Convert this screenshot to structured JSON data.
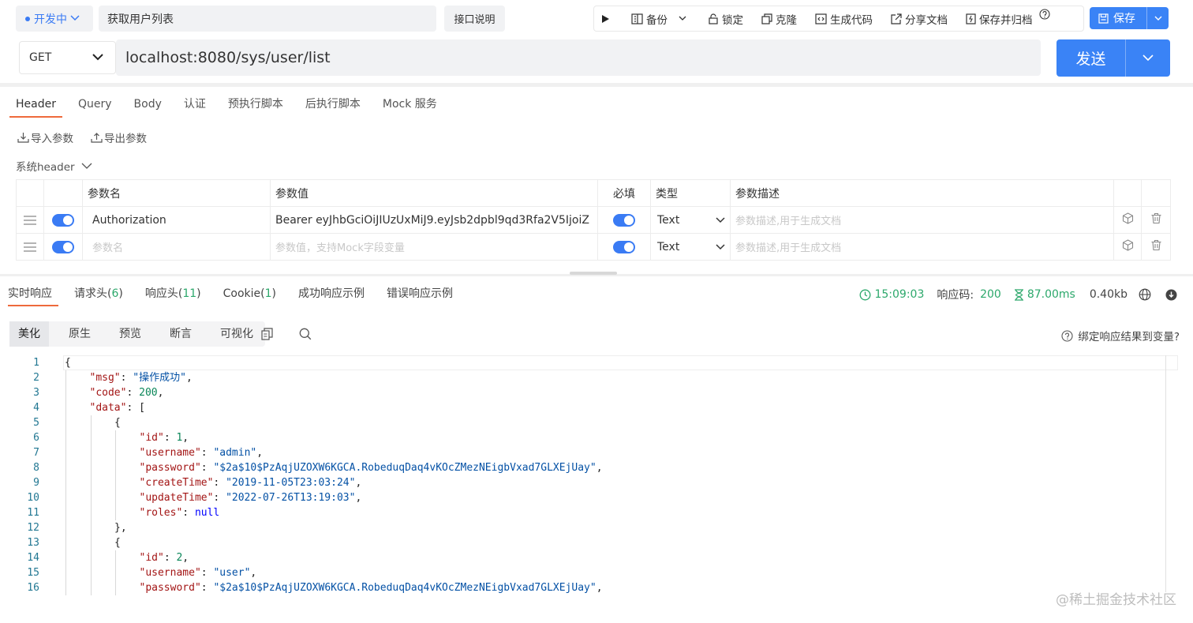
{
  "top": {
    "status_label": "开发中",
    "api_name": "获取用户列表",
    "doc_button": "接口说明",
    "toolbar": {
      "backup": "备份",
      "lock": "锁定",
      "clone": "克隆",
      "gen_code": "生成代码",
      "share_doc": "分享文档",
      "save_archive": "保存并归档"
    },
    "save_label": "保存",
    "method": "GET",
    "url": "localhost:8080/sys/user/list",
    "send_label": "发送"
  },
  "request": {
    "tabs": [
      "Header",
      "Query",
      "Body",
      "认证",
      "预执行脚本",
      "后执行脚本",
      "Mock 服务"
    ],
    "import_label": "导入参数",
    "export_label": "导出参数",
    "sys_header_label": "系统header",
    "columns": {
      "name": "参数名",
      "value": "参数值",
      "required": "必填",
      "type": "类型",
      "desc": "参数描述"
    },
    "rows": [
      {
        "name": "Authorization",
        "value": "Bearer  eyJhbGciOiJIUzUxMiJ9.eyJsb2dpbl9qd3Rfa2V5IjoiZ",
        "type": "Text",
        "desc_placeholder": "参数描述,用于生成文档"
      }
    ],
    "new_row": {
      "name_placeholder": "参数名",
      "value_placeholder": "参数值，支持Mock字段变量",
      "type": "Text",
      "desc_placeholder": "参数描述,用于生成文档"
    }
  },
  "response": {
    "tabs": [
      {
        "label": "实时响应",
        "count": ""
      },
      {
        "label": "请求头(",
        "count": "6",
        "suffix": ")"
      },
      {
        "label": "响应头(",
        "count": "11",
        "suffix": ")"
      },
      {
        "label": "Cookie(",
        "count": "1",
        "suffix": ")"
      },
      {
        "label": "成功响应示例",
        "count": ""
      },
      {
        "label": "错误响应示例",
        "count": ""
      }
    ],
    "time": "15:09:03",
    "code_label": "响应码:",
    "code": "200",
    "duration": "87.00ms",
    "size": "0.40kb",
    "view_tabs": [
      "美化",
      "原生",
      "预览",
      "断言",
      "可视化"
    ],
    "bind_label": "绑定响应结果到变量?",
    "watermark": "@稀土掘金技术社区",
    "code_lines": [
      {
        "n": "1",
        "indent": 0,
        "tokens": [
          [
            "p",
            "{"
          ]
        ]
      },
      {
        "n": "2",
        "indent": 1,
        "tokens": [
          [
            "k",
            "\"msg\""
          ],
          [
            "p",
            ": "
          ],
          [
            "s",
            "\"操作成功\""
          ],
          [
            "p",
            ","
          ]
        ]
      },
      {
        "n": "3",
        "indent": 1,
        "tokens": [
          [
            "k",
            "\"code\""
          ],
          [
            "p",
            ": "
          ],
          [
            "n",
            "200"
          ],
          [
            "p",
            ","
          ]
        ]
      },
      {
        "n": "4",
        "indent": 1,
        "tokens": [
          [
            "k",
            "\"data\""
          ],
          [
            "p",
            ": ["
          ]
        ]
      },
      {
        "n": "5",
        "indent": 2,
        "tokens": [
          [
            "p",
            "{"
          ]
        ]
      },
      {
        "n": "6",
        "indent": 3,
        "tokens": [
          [
            "k",
            "\"id\""
          ],
          [
            "p",
            ": "
          ],
          [
            "n",
            "1"
          ],
          [
            "p",
            ","
          ]
        ]
      },
      {
        "n": "7",
        "indent": 3,
        "tokens": [
          [
            "k",
            "\"username\""
          ],
          [
            "p",
            ": "
          ],
          [
            "s",
            "\"admin\""
          ],
          [
            "p",
            ","
          ]
        ]
      },
      {
        "n": "8",
        "indent": 3,
        "tokens": [
          [
            "k",
            "\"password\""
          ],
          [
            "p",
            ": "
          ],
          [
            "s",
            "\"$2a$10$PzAqjUZOXW6KGCA.RobeduqDaq4vKOcZMezNEigbVxad7GLXEjUay\""
          ],
          [
            "p",
            ","
          ]
        ]
      },
      {
        "n": "9",
        "indent": 3,
        "tokens": [
          [
            "k",
            "\"createTime\""
          ],
          [
            "p",
            ": "
          ],
          [
            "s",
            "\"2019-11-05T23:03:24\""
          ],
          [
            "p",
            ","
          ]
        ]
      },
      {
        "n": "10",
        "indent": 3,
        "tokens": [
          [
            "k",
            "\"updateTime\""
          ],
          [
            "p",
            ": "
          ],
          [
            "s",
            "\"2022-07-26T13:19:03\""
          ],
          [
            "p",
            ","
          ]
        ]
      },
      {
        "n": "11",
        "indent": 3,
        "tokens": [
          [
            "k",
            "\"roles\""
          ],
          [
            "p",
            ": "
          ],
          [
            "kw",
            "null"
          ]
        ]
      },
      {
        "n": "12",
        "indent": 2,
        "tokens": [
          [
            "p",
            "},"
          ]
        ]
      },
      {
        "n": "13",
        "indent": 2,
        "tokens": [
          [
            "p",
            "{"
          ]
        ]
      },
      {
        "n": "14",
        "indent": 3,
        "tokens": [
          [
            "k",
            "\"id\""
          ],
          [
            "p",
            ": "
          ],
          [
            "n",
            "2"
          ],
          [
            "p",
            ","
          ]
        ]
      },
      {
        "n": "15",
        "indent": 3,
        "tokens": [
          [
            "k",
            "\"username\""
          ],
          [
            "p",
            ": "
          ],
          [
            "s",
            "\"user\""
          ],
          [
            "p",
            ","
          ]
        ]
      },
      {
        "n": "16",
        "indent": 3,
        "tokens": [
          [
            "k",
            "\"password\""
          ],
          [
            "p",
            ": "
          ],
          [
            "s",
            "\"$2a$10$PzAqjUZOXW6KGCA.RobeduqDaq4vKOcZMezNEigbVxad7GLXEjUay\""
          ],
          [
            "p",
            ","
          ]
        ]
      }
    ]
  },
  "colors": {
    "primary": "#3a83f6",
    "tab_underline": "#ee6a3c",
    "success": "#2ca86b"
  }
}
